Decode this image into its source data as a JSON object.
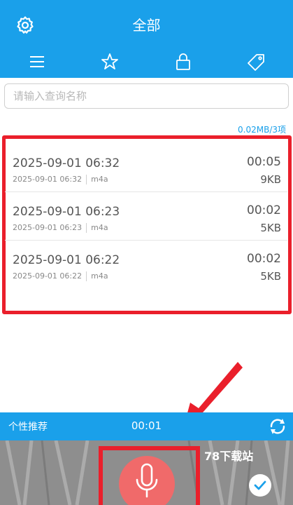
{
  "header": {
    "title": "全部",
    "tabs": [
      {
        "icon": "list-icon"
      },
      {
        "icon": "star-icon"
      },
      {
        "icon": "lock-icon"
      },
      {
        "icon": "tag-icon"
      }
    ]
  },
  "search": {
    "placeholder": "请输入查询名称"
  },
  "storage_info": "0.02MB/3项",
  "recordings": [
    {
      "title": "2025-09-01 06:32",
      "date": "2025-09-01 06:32",
      "format": "m4a",
      "duration": "00:05",
      "size": "9KB"
    },
    {
      "title": "2025-09-01 06:23",
      "date": "2025-09-01 06:23",
      "format": "m4a",
      "duration": "00:02",
      "size": "5KB"
    },
    {
      "title": "2025-09-01 06:22",
      "date": "2025-09-01 06:22",
      "format": "m4a",
      "duration": "00:02",
      "size": "5KB"
    }
  ],
  "bottom_bar": {
    "recommend_label": "个性推荐",
    "timer": "00:01"
  },
  "watermark": "78下载站",
  "colors": {
    "primary": "#1aa0ea",
    "highlight": "#ea1f2b",
    "mic": "#f06a6a"
  }
}
